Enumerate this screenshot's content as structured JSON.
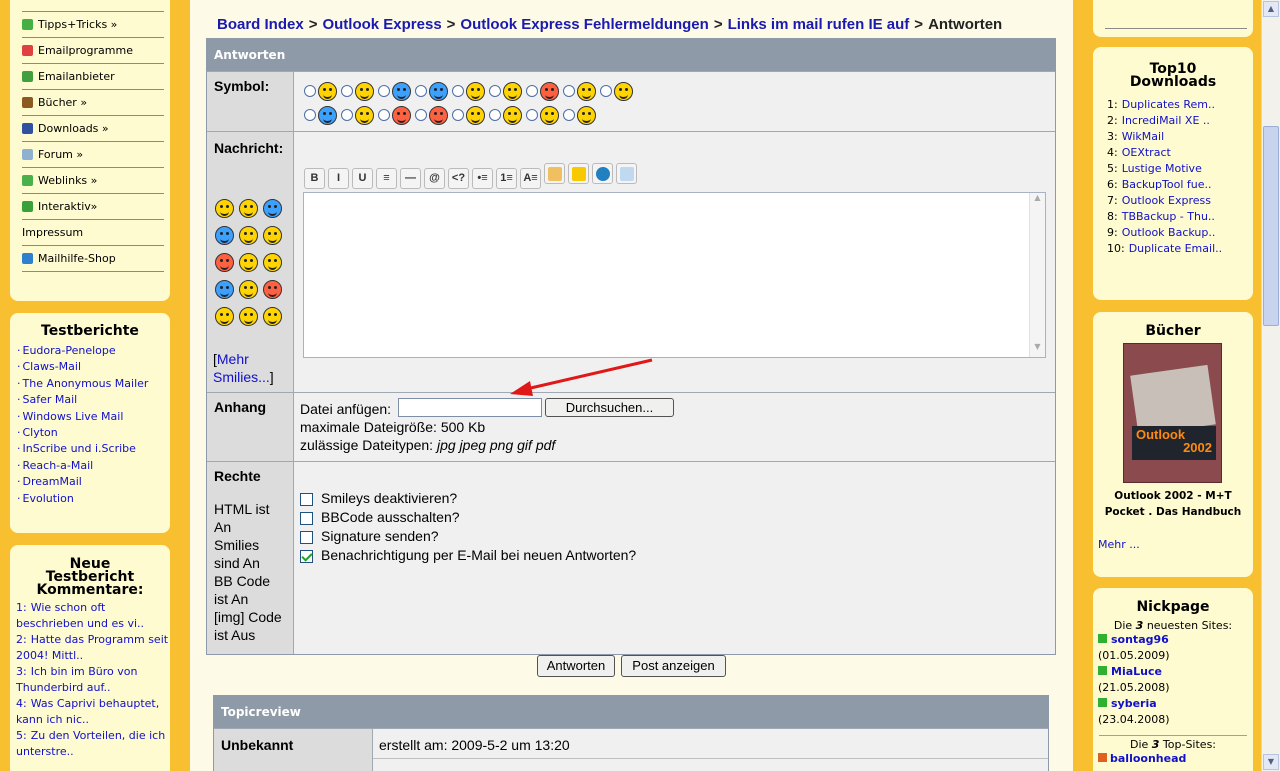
{
  "left_menu": {
    "items": [
      {
        "label": "Tipps+Tricks »",
        "icon": "tips-icon",
        "color": "#44b044"
      },
      {
        "label": "Emailprogramme",
        "icon": "email-program-icon",
        "color": "#e04040"
      },
      {
        "label": "Emailanbieter",
        "icon": "email-provider-icon",
        "color": "#40a040"
      },
      {
        "label": "Bücher »",
        "icon": "book-icon",
        "color": "#8a5a20"
      },
      {
        "label": "Downloads »",
        "icon": "floppy-icon",
        "color": "#3050a0"
      },
      {
        "label": "Forum »",
        "icon": "forum-icon",
        "color": "#90b0d0"
      },
      {
        "label": "Weblinks »",
        "icon": "weblinks-icon",
        "color": "#4ab04a"
      },
      {
        "label": "Interaktiv»",
        "icon": "interactive-icon",
        "color": "#3aa03a"
      },
      {
        "label": "Impressum",
        "icon": "",
        "color": ""
      },
      {
        "label": "Mailhilfe-Shop",
        "icon": "shop-cart-icon",
        "color": "#3080d0"
      }
    ]
  },
  "testberichte": {
    "title": "Testberichte",
    "items": [
      "Eudora-Penelope",
      "Claws-Mail",
      "The Anonymous Mailer",
      "Safer Mail",
      "Windows Live Mail",
      "Clyton",
      "InScribe und i.Scribe",
      "Reach-a-Mail",
      "DreamMail",
      "Evolution"
    ]
  },
  "kommentare": {
    "title_line1": "Neue",
    "title_line2": "Testbericht",
    "title_line3": "Kommentare:",
    "items": [
      {
        "num": "1:",
        "text": "Wie schon oft beschrieben und es vi.."
      },
      {
        "num": "2:",
        "text": "Hatte das Programm seit 2004! Mittl.."
      },
      {
        "num": "3:",
        "text": "Ich bin im Büro von Thunderbird auf.."
      },
      {
        "num": "4:",
        "text": "Was Caprivi behauptet, kann ich nic.."
      },
      {
        "num": "5:",
        "text": "Zu den Vorteilen, die ich unterstre.."
      }
    ]
  },
  "breadcrumb": {
    "items": [
      "Board Index",
      "Outlook Express",
      "Outlook Express Fehlermeldungen",
      "Links im mail rufen IE auf"
    ],
    "separator": ">",
    "current": "Antworten"
  },
  "form": {
    "header": "Antworten",
    "symbol_label": "Symbol:",
    "nachricht_label": "Nachricht:",
    "mehr_smilies": "[Mehr Smilies...]",
    "mehr_open": "[",
    "mehr_link": "Mehr Smilies...",
    "mehr_close": "]",
    "anhang_label": "Anhang",
    "datei_label": "Datei anfügen:",
    "browse_button": "Durchsuchen...",
    "max_size": "maximale Dateigröße: 500 Kb",
    "types_label": "zulässige Dateitypen:",
    "types_value": "jpg jpeg png gif pdf",
    "rechte_label": "Rechte",
    "rechte_lines": [
      "HTML ist",
      "An",
      "Smilies",
      "sind An",
      "BB Code",
      "ist An",
      "[img] Code",
      "ist Aus"
    ],
    "options": [
      {
        "label": "Smileys deaktivieren?",
        "checked": false
      },
      {
        "label": "BBCode ausschalten?",
        "checked": false
      },
      {
        "label": "Signature senden?",
        "checked": false
      },
      {
        "label": "Benachrichtigung per E-Mail bei neuen Antworten?",
        "checked": true
      }
    ],
    "toolbar": [
      "B",
      "I",
      "U",
      "≡",
      "—",
      "@",
      "<?",
      "•≡",
      "1≡",
      "A≡",
      "env",
      "tag",
      "globe",
      "img"
    ],
    "submit_button": "Antworten",
    "preview_button": "Post anzeigen"
  },
  "review": {
    "header": "Topicreview",
    "author": "Unbekannt",
    "created": "erstellt am: 2009-5-2 um 13:20"
  },
  "top10": {
    "title_line1": "Top10",
    "title_line2": "Downloads",
    "items": [
      {
        "num": "1:",
        "text": "Duplicates Rem.."
      },
      {
        "num": "2:",
        "text": "IncrediMail XE .."
      },
      {
        "num": "3:",
        "text": "WikMail"
      },
      {
        "num": "4:",
        "text": "OEXtract"
      },
      {
        "num": "5:",
        "text": "Lustige Motive"
      },
      {
        "num": "6:",
        "text": "BackupTool fue.."
      },
      {
        "num": "7:",
        "text": "Outlook Express"
      },
      {
        "num": "8:",
        "text": "TBBackup - Thu.."
      },
      {
        "num": "9:",
        "text": "Outlook Backup.."
      },
      {
        "num": "10:",
        "text": "Duplicate Email.."
      }
    ]
  },
  "buecher": {
    "title": "Bücher",
    "cover_title": "Outlook",
    "cover_year": "2002",
    "caption_line1": "Outlook 2002 - M+T",
    "caption_line2": "Pocket . Das Handbuch",
    "more": "Mehr ..."
  },
  "nickpage": {
    "title": "Nickpage",
    "newest_intro_pre": "Die",
    "newest_intro_num": "3",
    "newest_intro_post": "neuesten Sites:",
    "sites": [
      {
        "name": "sontag96",
        "date": "(01.05.2009)"
      },
      {
        "name": "MiaLuce",
        "date": "(21.05.2008)"
      },
      {
        "name": "syberia",
        "date": "(23.04.2008)"
      }
    ],
    "top_intro_pre": "Die",
    "top_intro_num": "3",
    "top_intro_post": "Top-Sites:",
    "top_first": "balloonhead"
  }
}
